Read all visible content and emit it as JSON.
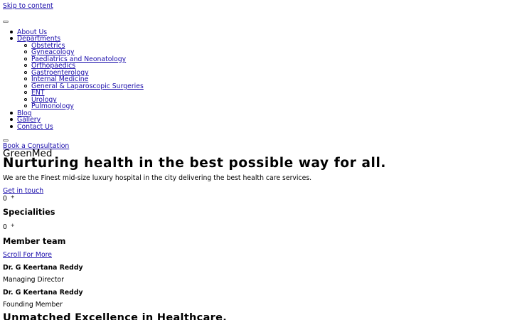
{
  "skip_link": "Skip to content",
  "nav": {
    "items": [
      {
        "label": "About Us"
      },
      {
        "label": "Departments"
      },
      {
        "label": "Blog"
      },
      {
        "label": "Gallery"
      },
      {
        "label": "Contact Us"
      }
    ],
    "departments": [
      "Obstetrics",
      "Gyneacology",
      "Paediatrics and Neonatology",
      "Orthopaedics",
      "Gastroenterology",
      "Internal Medicine",
      "General & Laparoscopic Surgeries",
      "ENT",
      "Urology",
      "Pulmonology"
    ]
  },
  "cta": {
    "book": "Book a Consultation",
    "get_in_touch": "Get in touch",
    "scroll": "Scroll For More"
  },
  "hero": {
    "brand": "GreenMed",
    "title": "Nurturing health in the best possible way for all.",
    "subtitle": "We are the Finest mid-size luxury hospital in the city delivering the best health care services."
  },
  "stats": [
    {
      "value": "0",
      "suffix": "+",
      "label": "Specialities"
    },
    {
      "value": "0",
      "suffix": "+",
      "label": "Member team"
    }
  ],
  "team": [
    {
      "name": "Dr. G Keertana Reddy",
      "role": "Managing Director"
    },
    {
      "name": "Dr. G Keertana Reddy",
      "role": "Founding Member"
    }
  ],
  "bottom_heading": "Unmatched Excellence in Healthcare."
}
